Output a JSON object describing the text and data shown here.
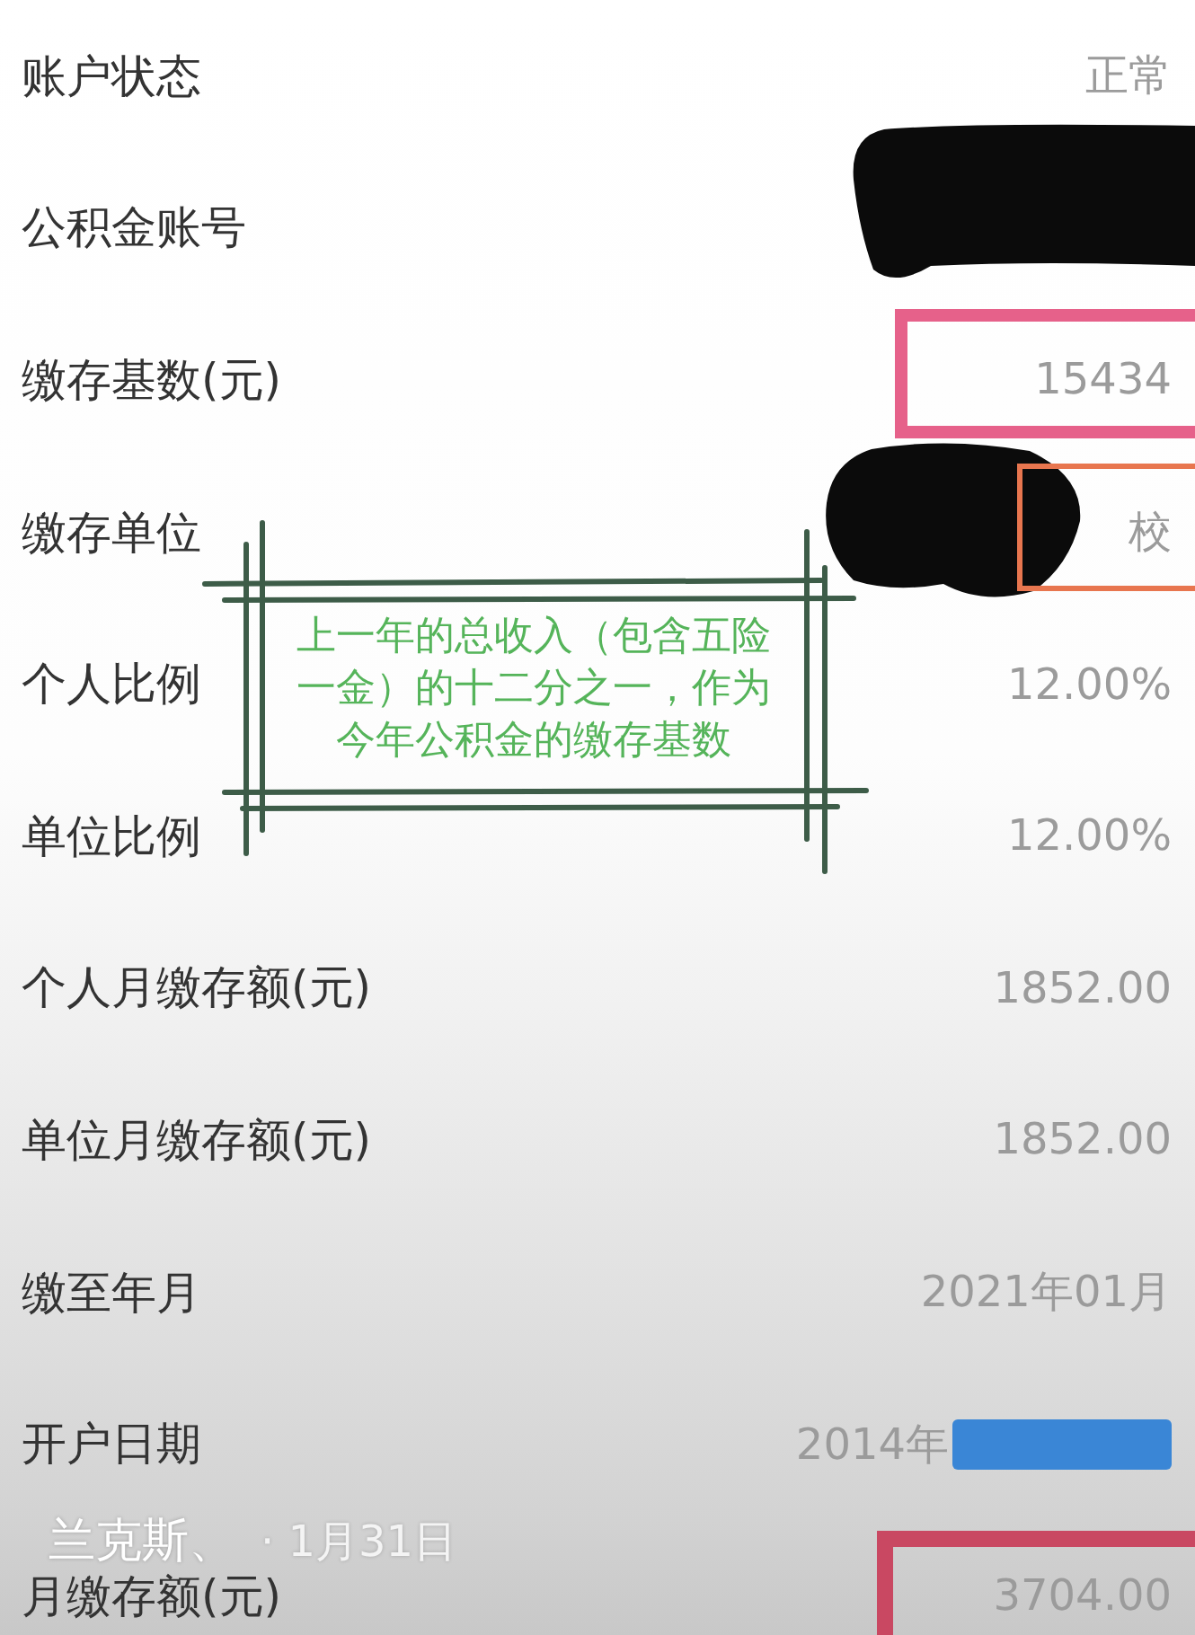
{
  "rows": [
    {
      "label": "账户状态",
      "value": "正常"
    },
    {
      "label": "公积金账号",
      "redaction": {
        "kind": "band"
      }
    },
    {
      "label": "缴存基数(元)",
      "value": "15434",
      "highlight": {
        "kind": "thick",
        "color": "#e6618a"
      }
    },
    {
      "label": "缴存单位",
      "value": "校",
      "redaction": {
        "kind": "blob"
      },
      "highlight": {
        "kind": "thin",
        "color": "#e8764f"
      }
    },
    {
      "label": "个人比例",
      "value": "12.00%"
    },
    {
      "label": "单位比例",
      "value": "12.00%"
    },
    {
      "label": "个人月缴存额(元)",
      "value": "1852.00"
    },
    {
      "label": "单位月缴存额(元)",
      "value": "1852.00"
    },
    {
      "label": "缴至年月",
      "value": "2021年01月"
    },
    {
      "label": "开户日期",
      "value": "2014年",
      "redaction": {
        "kind": "bar",
        "color": "#3a86d6"
      }
    },
    {
      "label": "月缴存额(元)",
      "value": "3704.00",
      "highlight": {
        "kind": "heavy",
        "color": "#c94862"
      }
    }
  ],
  "note": {
    "text": "上一年的总收入（包含五险一金）的十二分之一，作为今年公积金的缴存基数"
  },
  "post": {
    "author": "兰克斯、",
    "date": "· 1月31日"
  }
}
